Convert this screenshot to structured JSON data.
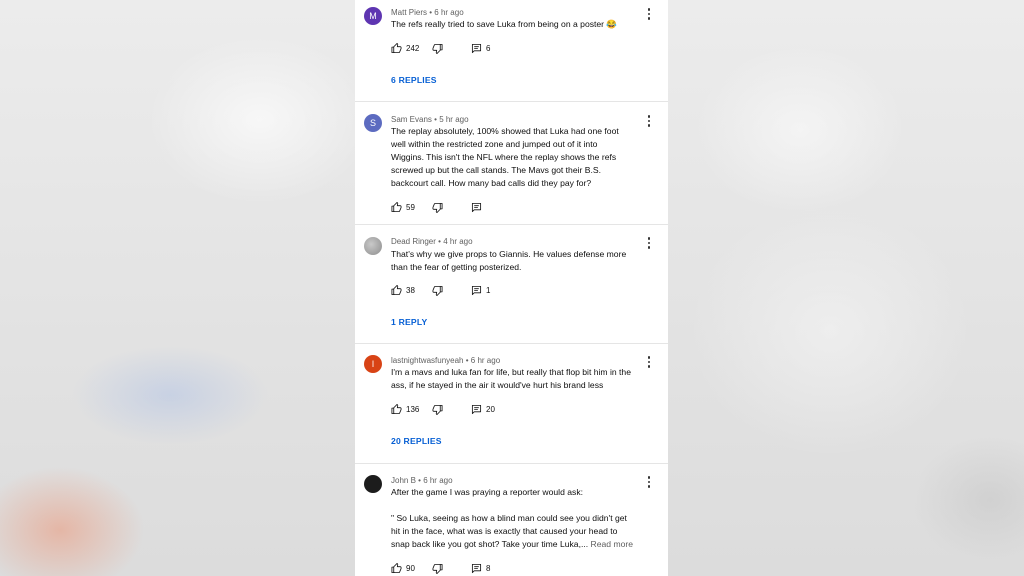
{
  "comments": [
    {
      "author": "Matt Piers",
      "age": "6 hr ago",
      "avatar_letter": "M",
      "avatar_color": "#5e35b1",
      "text_lines": [
        "The refs really tried to save Luka from being on a poster 😂"
      ],
      "likes": "242",
      "reply_count": "6",
      "replies_label": "6 REPLIES"
    },
    {
      "author": "Sam Evans",
      "age": "5 hr ago",
      "avatar_letter": "S",
      "avatar_color": "#5c6bc0",
      "text_lines": [
        "The replay absolutely, 100% showed that Luka had one foot",
        "well within the restricted zone and jumped out of it into",
        "Wiggins. This isn't the NFL where the replay shows the refs",
        "screwed up but the call stands. The Mavs got their B.S.",
        "backcourt call. How many bad calls did they pay for?"
      ],
      "likes": "59"
    },
    {
      "author": "Dead Ringer",
      "age": "4 hr ago",
      "avatar_color": "#9e9e9e",
      "text_lines": [
        "That's why we give props to Giannis. He values defense more",
        "than the fear of getting posterized."
      ],
      "likes": "38",
      "reply_count": "1",
      "replies_label": "1 REPLY"
    },
    {
      "author": "lastnightwasfunyeah",
      "age": "6 hr ago",
      "avatar_letter": "l",
      "avatar_color": "#d84315",
      "text_lines": [
        "I'm a mavs and luka fan for life, but really that flop bit him in the",
        "ass, if he stayed in the air it would've hurt his brand less"
      ],
      "likes": "136",
      "reply_count": "20",
      "replies_label": "20 REPLIES"
    },
    {
      "author": "John B",
      "age": "6 hr ago",
      "avatar_color": "#1c1c1c",
      "text_lines": [
        "After the game I was praying a reporter would ask:",
        "",
        "\" So Luka, seeing as how a blind man could see you didn't get",
        "hit in the face, what was is exactly that caused your head to",
        "snap back like you got shot? Take your time Luka,..."
      ],
      "read_more": "Read more",
      "likes": "90",
      "reply_count": "8"
    }
  ],
  "meta_separator": "•",
  "icons": {
    "like": "thumbs-up-icon",
    "dislike": "thumbs-down-icon",
    "reply": "reply-icon",
    "menu": "more-vert-icon"
  }
}
